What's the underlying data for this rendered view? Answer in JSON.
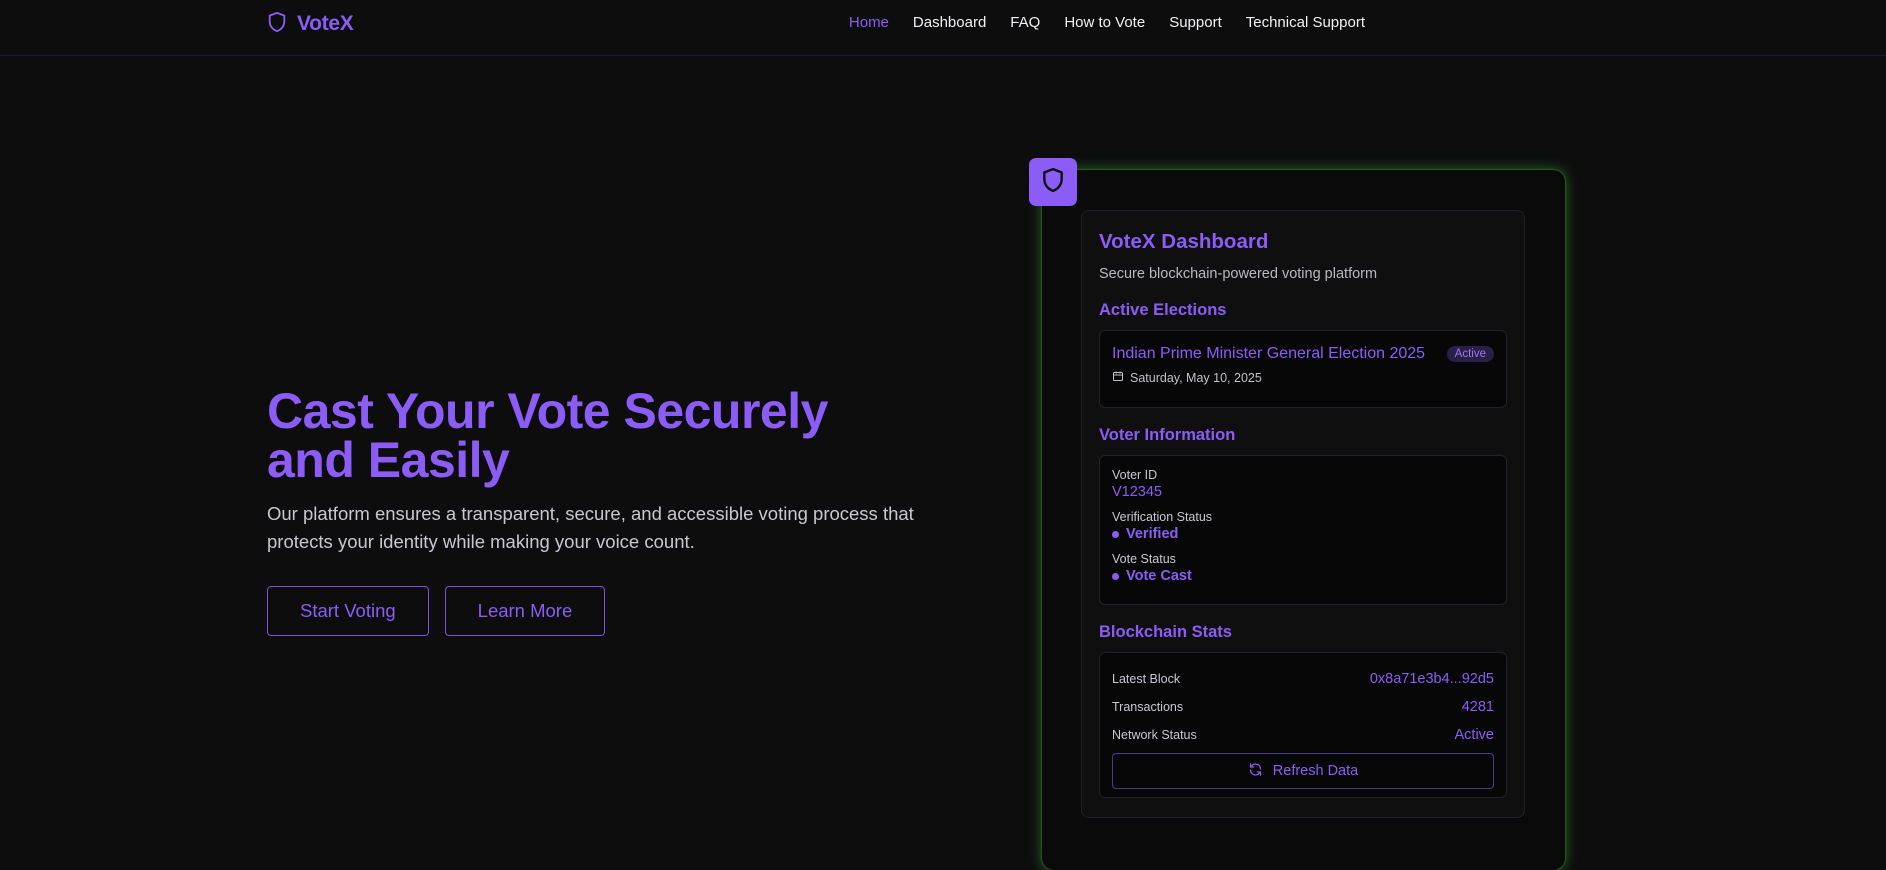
{
  "navbar": {
    "brand": "VoteX",
    "links": [
      {
        "label": "Home"
      },
      {
        "label": "Dashboard"
      },
      {
        "label": "FAQ"
      },
      {
        "label": "How to Vote"
      },
      {
        "label": "Support"
      },
      {
        "label": "Technical Support"
      }
    ],
    "active_link": "Home"
  },
  "hero": {
    "title_line1": "Cast Your Vote Securely",
    "title_line2": "and Easily",
    "subtitle": "Our platform ensures a transparent, secure, and accessible voting process that protects your identity while making your voice count.",
    "start_button": "Start Voting",
    "learn_button": "Learn More"
  },
  "dashboard": {
    "title": "VoteX Dashboard",
    "subtitle": "Secure blockchain-powered voting platform",
    "active_elections": {
      "heading": "Active Elections",
      "items": [
        {
          "name": "Indian Prime Minister General Election 2025",
          "badge": "Active",
          "date": "Saturday, May 10, 2025"
        }
      ]
    },
    "voter_info": {
      "heading": "Voter Information",
      "voter_id_label": "Voter ID",
      "voter_id": "V12345",
      "verification_label": "Verification Status",
      "verification_value": "Verified",
      "vote_status_label": "Vote Status",
      "vote_status_value": "Vote Cast"
    },
    "blockchain": {
      "heading": "Blockchain Stats",
      "latest_block_label": "Latest Block",
      "latest_block": "0x8a71e3b4...92d5",
      "transactions_label": "Transactions",
      "transactions": "4281",
      "network_label": "Network Status",
      "network": "Active",
      "refresh_button": "Refresh Data"
    }
  },
  "colors": {
    "accent": "#8b5cf6",
    "background": "#0d0d0e",
    "glow": "#4ade3c"
  },
  "icons": {
    "brand": "shield-icon",
    "badge": "shield-icon",
    "date": "calendar-icon",
    "refresh": "refresh-icon"
  }
}
